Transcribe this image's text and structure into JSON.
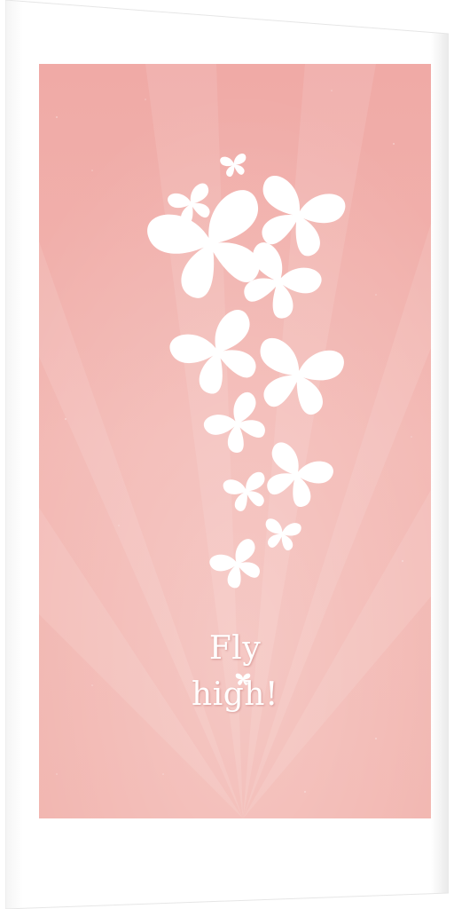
{
  "poster": {
    "line1": "Fly",
    "line2": "high!"
  },
  "colors": {
    "background": "#f2b2ad",
    "frame": "#ffffff",
    "butterfly": "#ffffff"
  },
  "icons": [
    "butterfly-icon"
  ]
}
